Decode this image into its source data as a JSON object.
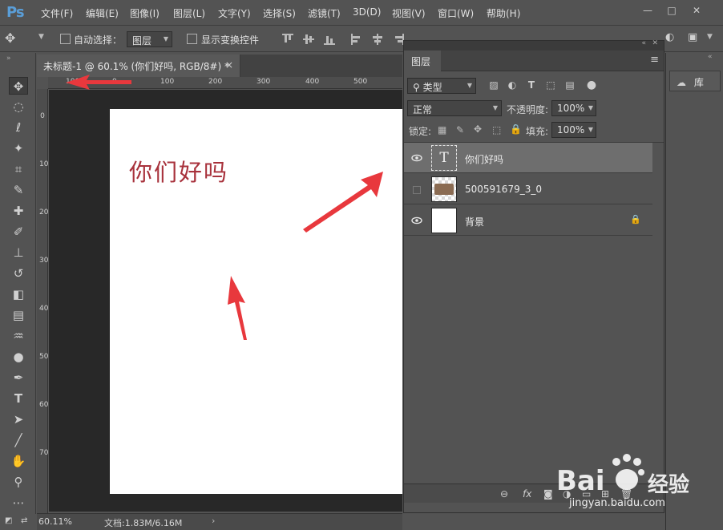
{
  "app": {
    "logo": "Ps"
  },
  "menu": [
    "文件(F)",
    "编辑(E)",
    "图像(I)",
    "图层(L)",
    "文字(Y)",
    "选择(S)",
    "滤镜(T)",
    "3D(D)",
    "视图(V)",
    "窗口(W)",
    "帮助(H)"
  ],
  "window_controls": {
    "minimize": "—",
    "restore": "□",
    "close": "✕"
  },
  "options": {
    "auto_select_label": "自动选择：",
    "auto_select_value": "图层",
    "show_transform_label": "显示变换控件"
  },
  "document": {
    "tab_title": "未标题-1 @ 60.1% (你们好吗, RGB/8#) *",
    "tab_close": "×",
    "canvas_text": "你们好吗",
    "zoom": "60.11%",
    "doc_info": "文档:1.83M/6.16M"
  },
  "rulers": {
    "top": [
      "100",
      "0",
      "100",
      "200",
      "300",
      "400",
      "500"
    ],
    "left": [
      "0",
      "100",
      "200",
      "300",
      "400",
      "500",
      "600",
      "700"
    ]
  },
  "layers_panel": {
    "title": "图层",
    "filter_kind": "类型",
    "blend_mode": "正常",
    "opacity_label": "不透明度:",
    "opacity_value": "100%",
    "lock_label": "锁定:",
    "fill_label": "填充:",
    "fill_value": "100%",
    "layers": [
      {
        "name": "你们好吗",
        "type": "text",
        "visible": true,
        "selected": true
      },
      {
        "name": "500591679_3_0",
        "type": "image",
        "visible": false,
        "selected": false
      },
      {
        "name": "背景",
        "type": "background",
        "visible": true,
        "selected": false,
        "locked": true
      }
    ]
  },
  "right_dock": {
    "library_label": "库"
  },
  "watermark": {
    "brand": "Bai",
    "brand2": "经验",
    "url": "jingyan.baidu.com"
  },
  "colors": {
    "canvas_text": "#a8323c",
    "arrow": "#e8383d",
    "selected_layer": "#6e6e6e"
  }
}
